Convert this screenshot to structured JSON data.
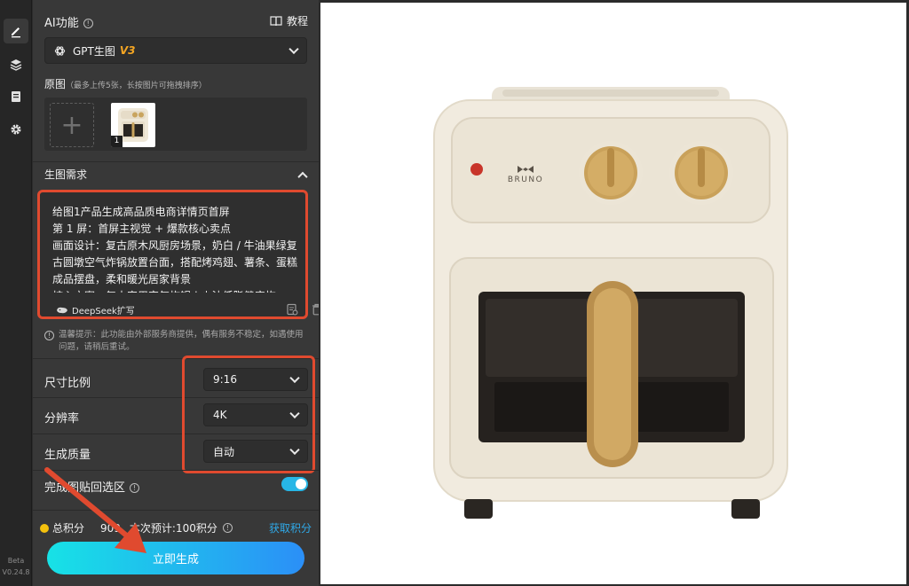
{
  "sidebar": {
    "items": [
      {
        "icon": "edit-icon",
        "active": true
      },
      {
        "icon": "layers-icon",
        "active": false
      },
      {
        "icon": "document-icon",
        "active": false
      },
      {
        "icon": "gear-icon",
        "active": false
      }
    ],
    "beta_label": "Beta",
    "version": "V0.24.8"
  },
  "ai": {
    "title": "AI功能",
    "tutorial_label": "教程",
    "model_name": "GPT生图",
    "model_version": "V3"
  },
  "original": {
    "title": "原图",
    "hint": "（最多上传5张，长按图片可拖拽排序）",
    "thumb_index": "1"
  },
  "prompt_section": {
    "title": "生图需求",
    "text": "给图1产品生成高品质电商详情页首屏\n第 1 屏：首屏主视觉 + 爆款核心卖点\n画面设计：复古原木风厨房场景，奶白 / 牛油果绿复古圆墩空气炸锅放置台面，搭配烤鸡翅、薯条、蛋糕成品摆盘，柔和暖光居家背景\n核心文案：复古家用空气炸锅 | 少油低脂健康炸",
    "deepseek_label": "DeepSeek扩写"
  },
  "tip": {
    "text": "温馨提示：此功能由外部服务商提供，偶有服务不稳定，如遇使用问题，请稍后重试。"
  },
  "settings": {
    "ratio_label": "尺寸比例",
    "ratio_value": "9:16",
    "resolution_label": "分辨率",
    "resolution_value": "4K",
    "quality_label": "生成质量",
    "quality_value": "自动",
    "paste_back_label": "完成图贴回选区",
    "paste_back_on": true
  },
  "footer": {
    "points_text": "总积分",
    "points_value": "909",
    "estimate_text": "本次预计:100积分",
    "get_points": "获取积分",
    "generate_label": "立即生成"
  },
  "canvas": {
    "brand_text": "BRUNO"
  },
  "colors": {
    "accent_red": "#e04a2f",
    "button_gradient_start": "#17e2e6",
    "button_gradient_end": "#2b8ff7",
    "link_blue": "#2fa9e8",
    "toggle_on": "#27b6e6",
    "coin_yellow": "#f4c10d",
    "model_version": "#f5a623"
  }
}
